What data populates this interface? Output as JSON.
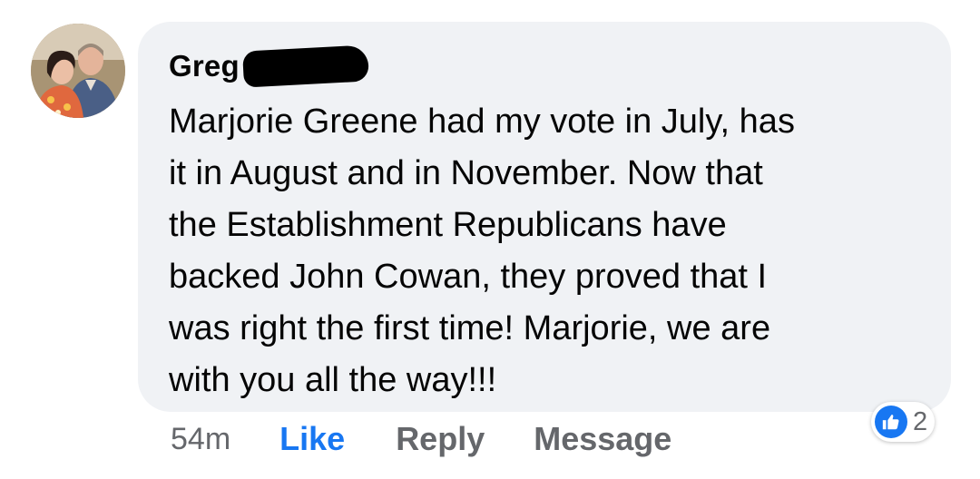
{
  "comment": {
    "author": "Greg",
    "text": "Marjorie Greene had my vote in July,  has\nit in August and in November. Now that\nthe Establishment Republicans have\nbacked John Cowan, they proved that I\nwas right the first time! Marjorie,  we are\nwith you all the way!!!"
  },
  "actions": {
    "timestamp": "54m",
    "like_label": "Like",
    "reply_label": "Reply",
    "message_label": "Message"
  },
  "reactions": {
    "icon": "thumbs-up-icon",
    "count": "2",
    "color": "#1877f2"
  },
  "colors": {
    "bubble": "#f0f2f5",
    "secondary_text": "#65676b",
    "accent": "#1877f2"
  }
}
